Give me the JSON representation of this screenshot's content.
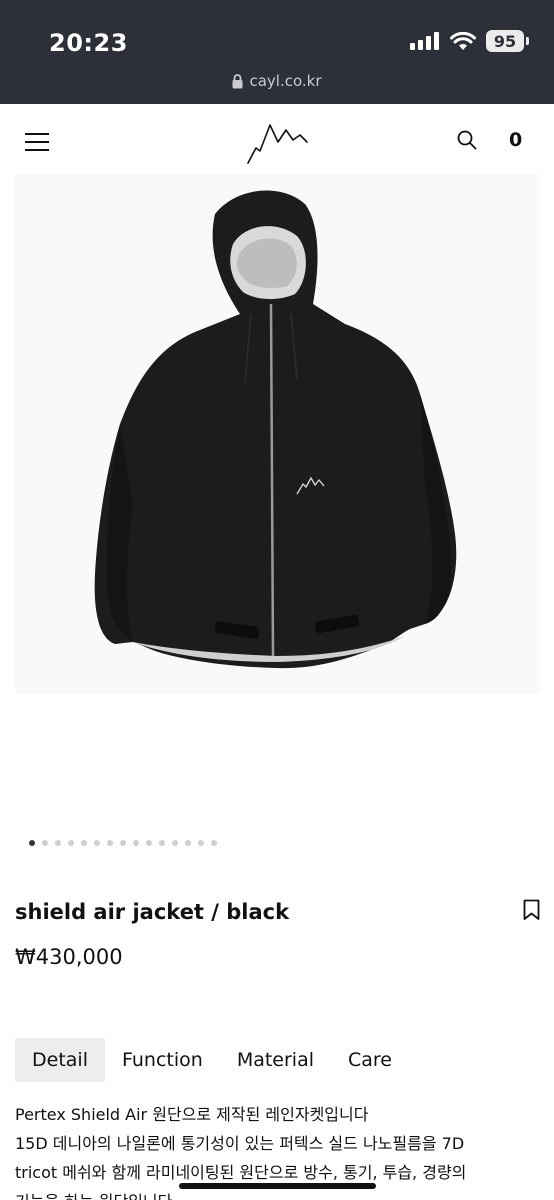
{
  "status_bar": {
    "time": "20:23",
    "battery": "95",
    "icons": [
      "signal-icon",
      "wifi-icon"
    ]
  },
  "browser": {
    "url": "cayl.co.kr",
    "lock_icon": "lock-icon"
  },
  "header": {
    "menu_icon": "hamburger-icon",
    "logo_icon": "mountain-logo-icon",
    "search_icon": "search-icon",
    "cart_count": "0"
  },
  "gallery": {
    "image": "black hooded rain jacket",
    "total_slides": 15,
    "active_slide": 1
  },
  "product": {
    "title": "shield air jacket / black",
    "price": "₩430,000",
    "bookmark_icon": "bookmark-icon"
  },
  "tabs": [
    {
      "label": "Detail",
      "active": true
    },
    {
      "label": "Function",
      "active": false
    },
    {
      "label": "Material",
      "active": false
    },
    {
      "label": "Care",
      "active": false
    }
  ],
  "description": {
    "line1": "Pertex Shield Air 원단으로 제작된 레인자켓입니다",
    "line2": "15D 데니아의 나일론에 통기성이 있는 퍼텍스 실드 나노필름을 7D",
    "line3": "tricot 메쉬와 함께 라미네이팅된 원단으로 방수, 통기, 투습, 경량의",
    "line4": "기능을 하는 원단입니다"
  }
}
